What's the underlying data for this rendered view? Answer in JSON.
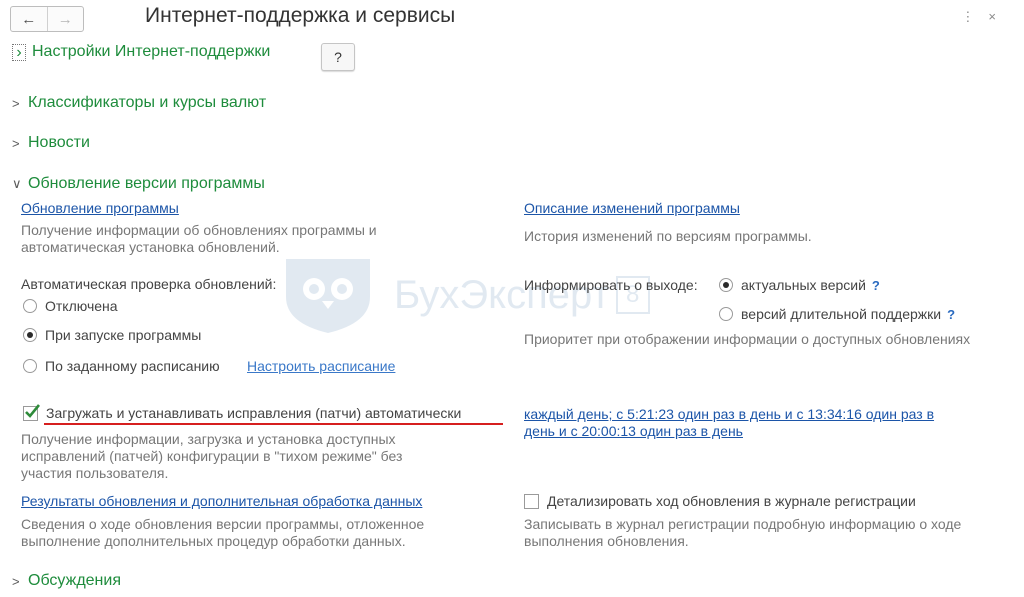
{
  "window": {
    "title": "Интернет-поддержка и сервисы",
    "back": "←",
    "forward": "→",
    "more_icon": "⋮",
    "close_icon": "×"
  },
  "sections": {
    "settings": "Настройки Интернет-поддержки",
    "help": "?",
    "classifiers": "Классификаторы и курсы валют",
    "news": "Новости",
    "update": "Обновление версии программы",
    "discussions": "Обсуждения"
  },
  "update": {
    "program_update_link": "Обновление программы",
    "program_update_desc": "Получение информации об обновлениях программы и автоматическая установка обновлений.",
    "changes_link": "Описание изменений программы",
    "changes_desc": "История изменений по версиям программы.",
    "auto_check_label": "Автоматическая проверка обновлений:",
    "radio_off": "Отключена",
    "radio_startup": "При запуске программы",
    "radio_schedule": "По заданному расписанию",
    "schedule_link": "Настроить расписание",
    "inform_label": "Информировать о выходе:",
    "inform_actual": "актуальных версий",
    "inform_lts": "версий длительной поддержки",
    "inform_q": "?",
    "priority_desc": "Приоритет при отображении информации о доступных обновлениях",
    "patches_label": "Загружать и устанавливать исправления (патчи) автоматически",
    "patches_schedule": "каждый день; с 5:21:23 один раз в день и с 13:34:16 один раз в день и с 20:00:13 один раз в день",
    "patches_desc": "Получение информации, загрузка и установка доступных исправлений (патчей) конфигурации в \"тихом режиме\" без участия пользователя.",
    "results_link": "Результаты обновления и дополнительная обработка данных",
    "results_desc": "Сведения о ходе обновления версии программы, отложенное выполнение дополнительных процедур обработки данных.",
    "detail_label": "Детализировать ход обновления в журнале регистрации",
    "detail_desc": "Записывать в журнал регистрации подробную информацию о ходе выполнения обновления."
  },
  "watermark": {
    "text": "БухЭксперт",
    "badge": "8"
  },
  "colors": {
    "section_green": "#1e8c3c",
    "link_blue": "#1c55a8",
    "underline_red": "#d61f1f"
  }
}
